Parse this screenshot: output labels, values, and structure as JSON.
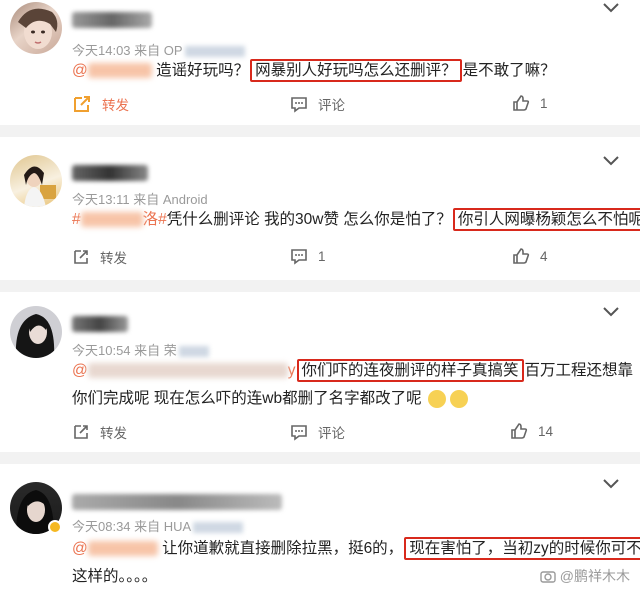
{
  "posts": [
    {
      "time": "今天14:03",
      "from": "来自 OP",
      "line1_pre": "造谣好玩吗？",
      "line1_hl": "网暴别人好玩吗怎么还删评？",
      "line1_post": "是不敢了嘛？",
      "share_label": "转发",
      "comment_label": "评论",
      "like_count": "1"
    },
    {
      "time": "今天13:11",
      "from": "来自 Android",
      "hashtag_start": "#",
      "hashtag_end": "洛#",
      "line1_pre": "凭什么删评论 我的30w赞 怎么你是怕了？",
      "line1_hl": "你引人网曝杨颖怎么不怕呢?",
      "share_label": "转发",
      "comment_count": "1",
      "like_count": "4"
    },
    {
      "time": "今天10:54",
      "from": "来自 荣",
      "line1_end_letter": "y",
      "line1_hl": "你们吓的连夜删评的样子真搞笑",
      "line1_post": "百万工程还想靠",
      "line2": "你们完成呢 现在怎么吓的连wb都删了名字都改了呢",
      "share_label": "转发",
      "comment_label": "评论",
      "like_count": "14"
    },
    {
      "time": "今天08:34",
      "from": "来自 HUA",
      "line1_pre": "让你道歉就直接删除拉黑，挺6的，",
      "line1_hl": "现在害怕了，当初zy的时候你可不是",
      "line2": "这样的。。。。"
    }
  ],
  "watermark": "@鹏祥木木",
  "colors": {
    "highlight_border": "#d8291c",
    "hashtag": "#eb7350",
    "mention": "#eb7350",
    "share_icon": "#f0a030"
  }
}
